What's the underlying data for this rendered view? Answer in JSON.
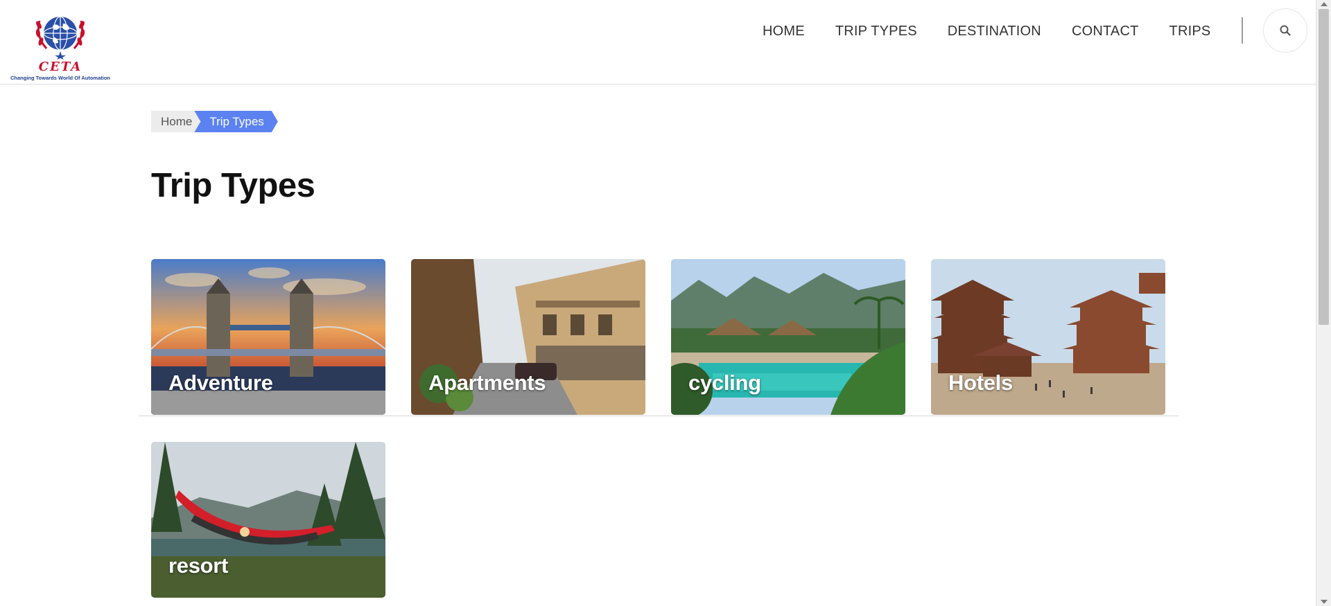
{
  "logo": {
    "title": "CETA",
    "tagline": "Changing Towards World Of Automation"
  },
  "nav": {
    "items": [
      {
        "label": "HOME"
      },
      {
        "label": "TRIP TYPES"
      },
      {
        "label": "DESTINATION"
      },
      {
        "label": "CONTACT"
      },
      {
        "label": "TRIPS"
      }
    ],
    "search_icon": "search-icon"
  },
  "breadcrumb": {
    "home": "Home",
    "current": "Trip Types"
  },
  "page": {
    "title": "Trip Types"
  },
  "trip_types": [
    {
      "label": "Adventure",
      "image": "tower-bridge-sunset"
    },
    {
      "label": "Apartments",
      "image": "old-town-street"
    },
    {
      "label": "cycling",
      "image": "tropical-resort-pool"
    },
    {
      "label": "Hotels",
      "image": "pagoda-temple-square"
    },
    {
      "label": "resort",
      "image": "hammock-in-forest"
    }
  ],
  "colors": {
    "accent": "#5b82f0",
    "logo_red": "#c8102e",
    "logo_blue": "#1f3f8f"
  }
}
